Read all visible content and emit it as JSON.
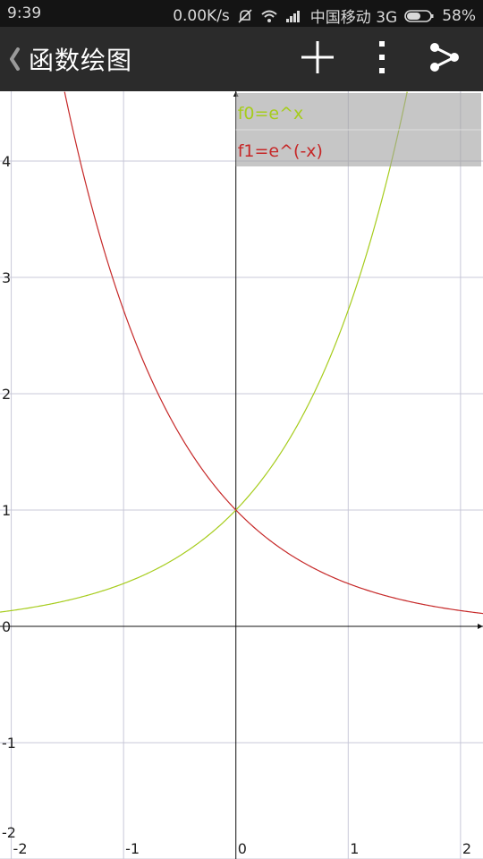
{
  "status_bar": {
    "time": "9:39",
    "net_speed": "0.00K/s",
    "carrier": "中国移动 3G",
    "battery": "58%",
    "icons": [
      "mute-icon",
      "wifi-icon",
      "signal-icon",
      "battery-icon"
    ]
  },
  "app_bar": {
    "back_icon": "chevron-left-icon",
    "title": "函数绘图",
    "actions": [
      "plus-icon",
      "more-vertical-icon",
      "share-icon"
    ]
  },
  "chart_data": {
    "type": "line",
    "xlim": [
      -2.1,
      2.2
    ],
    "ylim": [
      -2.0,
      4.6
    ],
    "x_ticks": [
      -2,
      -1,
      0,
      1,
      2
    ],
    "y_ticks": [
      -2,
      -1,
      0,
      1,
      2,
      3,
      4
    ],
    "x_tick_labels": [
      "-2",
      "-1",
      "0",
      "1",
      "2"
    ],
    "y_tick_labels": [
      "-2",
      "-1",
      "0",
      "1",
      "2",
      "3",
      "4"
    ],
    "grid": true,
    "legend_position": "top-right",
    "series": [
      {
        "name": "f0=e^x",
        "color": "#a6cc1c",
        "x": [
          -2.1,
          -1.5,
          -1.0,
          -0.5,
          0.0,
          0.5,
          1.0,
          1.25,
          1.5,
          1.525
        ],
        "y": [
          0.122,
          0.223,
          0.368,
          0.607,
          1.0,
          1.649,
          2.718,
          3.49,
          4.482,
          4.6
        ]
      },
      {
        "name": "f1=e^(-x)",
        "color": "#c62828",
        "x": [
          -1.525,
          -1.5,
          -1.25,
          -1.0,
          -0.5,
          0.0,
          0.5,
          1.0,
          1.5,
          2.2
        ],
        "y": [
          4.6,
          4.482,
          3.49,
          2.718,
          1.649,
          1.0,
          0.607,
          0.368,
          0.223,
          0.111
        ]
      }
    ]
  }
}
